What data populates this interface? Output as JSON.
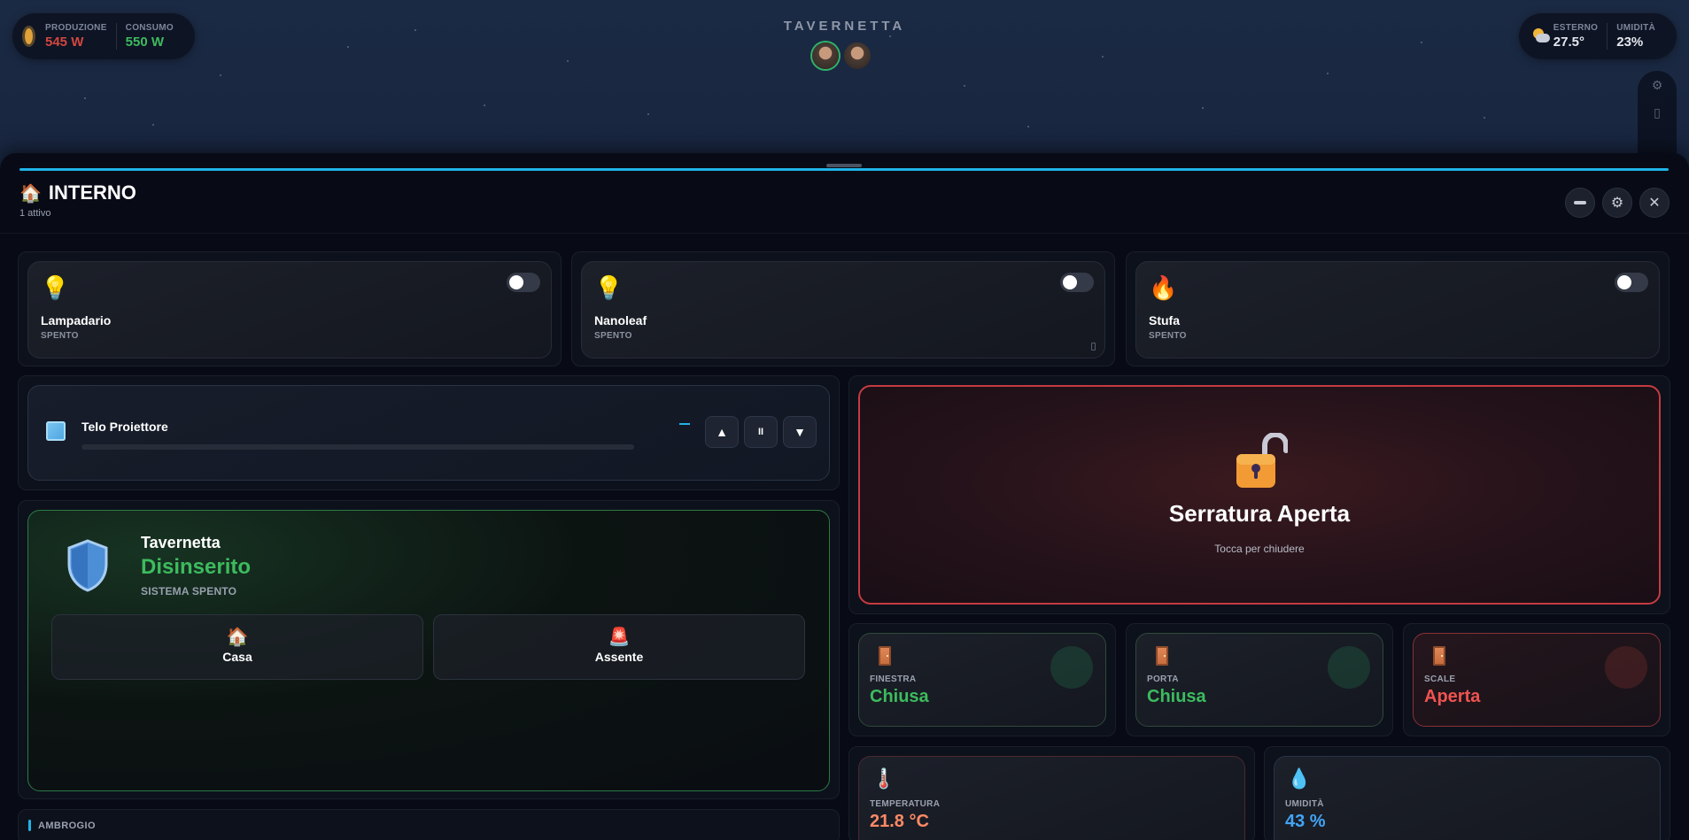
{
  "topbar": {
    "energy": {
      "production_label": "PRODUZIONE",
      "production_value": "545 W",
      "consumption_label": "CONSUMO",
      "consumption_value": "550 W"
    },
    "room_title": "TAVERNETTA",
    "weather": {
      "outside_label": "ESTERNO",
      "outside_value": "27.5°",
      "humidity_label": "UMIDITÀ",
      "humidity_value": "23%"
    }
  },
  "panel": {
    "title": "INTERNO",
    "subtitle": "1 attivo",
    "accent_color": "#1fb3e8"
  },
  "switches": [
    {
      "name": "Lampadario",
      "state": "SPENTO",
      "icon": "lightbulb-icon",
      "glyph": "💡"
    },
    {
      "name": "Nanoleaf",
      "state": "SPENTO",
      "icon": "lightbulb-icon",
      "glyph": "💡"
    },
    {
      "name": "Stufa",
      "state": "SPENTO",
      "icon": "fire-icon",
      "glyph": "🔥"
    }
  ],
  "cover": {
    "name": "Telo Proiettore",
    "position_indicator": "–"
  },
  "alarm": {
    "room": "Tavernetta",
    "state": "Disinserito",
    "subtitle": "SISTEMA SPENTO",
    "state_color": "#3dbb5e",
    "modes": [
      {
        "label": "Casa",
        "glyph": "🏠"
      },
      {
        "label": "Assente",
        "glyph": "🚨"
      }
    ]
  },
  "lock": {
    "title": "Serratura Aperta",
    "subtitle": "Tocca per chiudere",
    "color": "#c43b42"
  },
  "sensors": [
    {
      "label": "FINESTRA",
      "value": "Chiusa",
      "status": "closed",
      "color": "#3dbb5e"
    },
    {
      "label": "PORTA",
      "value": "Chiusa",
      "status": "closed",
      "color": "#3dbb5e"
    },
    {
      "label": "SCALE",
      "value": "Aperta",
      "status": "open",
      "color": "#ef5350"
    }
  ],
  "measurements": [
    {
      "label": "TEMPERATURA",
      "value": "21.8 °C",
      "glyph": "🌡️",
      "color": "#ff8a65"
    },
    {
      "label": "UMIDITÀ",
      "value": "43 %",
      "glyph": "💧",
      "color": "#42a5f5"
    }
  ],
  "section": {
    "label": "AMBROGIO"
  }
}
